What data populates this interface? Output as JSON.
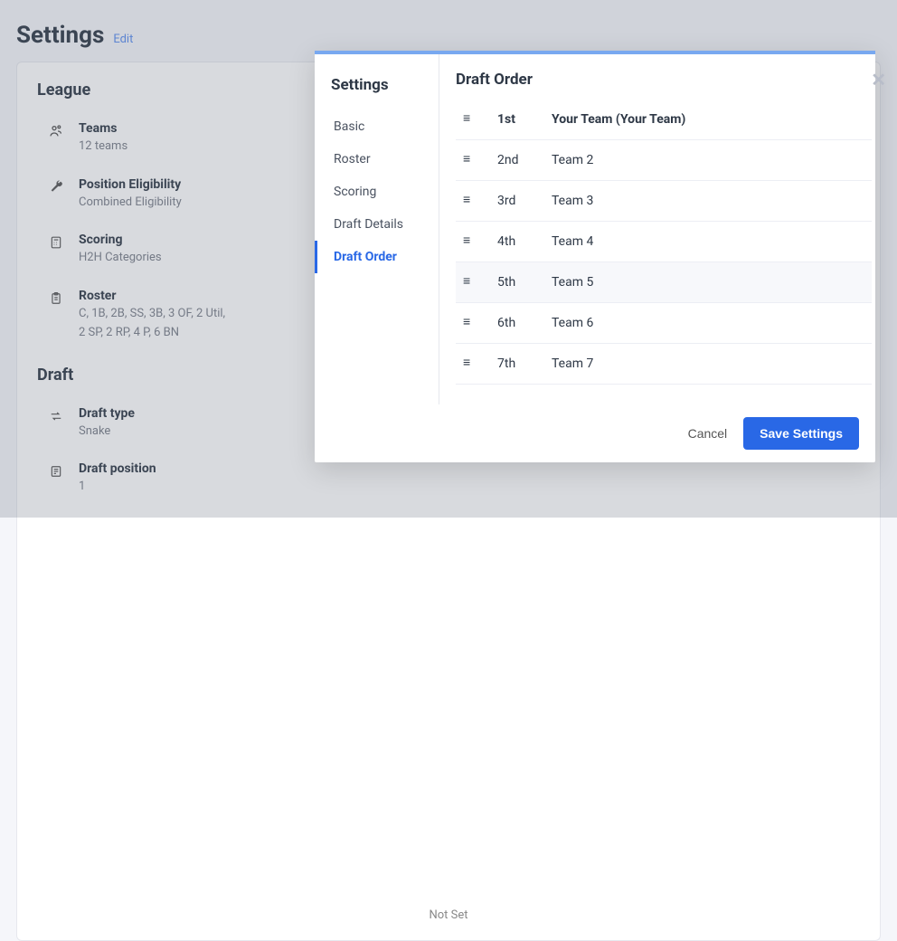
{
  "header": {
    "title": "Settings",
    "edit_link": "Edit"
  },
  "league": {
    "section_title": "League",
    "teams_label": "Teams",
    "teams_value": "12 teams",
    "position_elig_label": "Position Eligibility",
    "position_elig_value": "Combined Eligibility",
    "scoring_label": "Scoring",
    "scoring_value": "H2H Categories",
    "roster_label": "Roster",
    "roster_value_line1": "C, 1B, 2B, SS, 3B, 3 OF, 2 Util,",
    "roster_value_line2": "2 SP, 2 RP, 4 P, 6 BN"
  },
  "draft": {
    "section_title": "Draft",
    "type_label": "Draft type",
    "type_value": "Snake",
    "position_label": "Draft position",
    "position_value": "1"
  },
  "notset_text": "Not Set",
  "modal": {
    "sidebar_title": "Settings",
    "nav": {
      "basic": "Basic",
      "roster": "Roster",
      "scoring": "Scoring",
      "draft_details": "Draft Details",
      "draft_order": "Draft Order"
    },
    "main_title": "Draft Order",
    "order": [
      {
        "pos": "1st",
        "team": "Your Team (Your Team)"
      },
      {
        "pos": "2nd",
        "team": "Team 2"
      },
      {
        "pos": "3rd",
        "team": "Team 3"
      },
      {
        "pos": "4th",
        "team": "Team 4"
      },
      {
        "pos": "5th",
        "team": "Team 5"
      },
      {
        "pos": "6th",
        "team": "Team 6"
      },
      {
        "pos": "7th",
        "team": "Team 7"
      }
    ],
    "cancel_label": "Cancel",
    "save_label": "Save Settings"
  }
}
